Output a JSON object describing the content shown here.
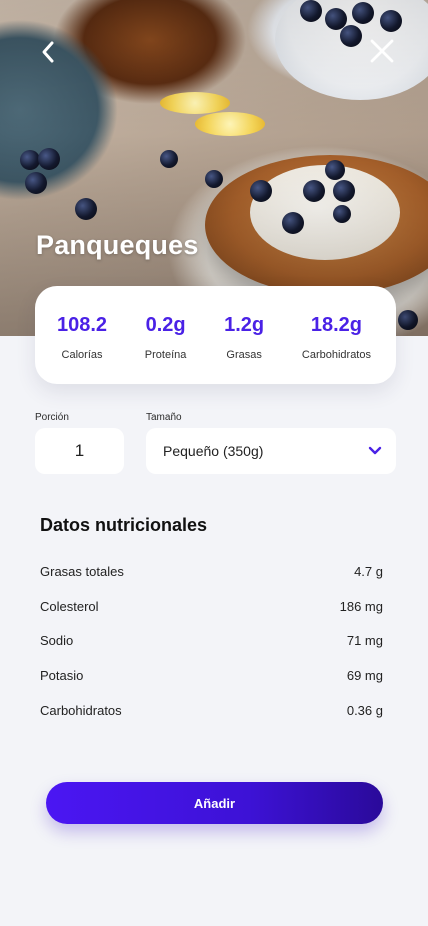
{
  "header": {
    "title": "Panqueques"
  },
  "stats": [
    {
      "value": "108.2",
      "label": "Calorías"
    },
    {
      "value": "0.2g",
      "label": "Proteína"
    },
    {
      "value": "1.2g",
      "label": "Grasas"
    },
    {
      "value": "18.2g",
      "label": "Carbohidratos"
    }
  ],
  "portion": {
    "label": "Porción",
    "value": "1"
  },
  "size": {
    "label": "Tamaño",
    "selected": "Pequeño (350g)"
  },
  "nutrition": {
    "title": "Datos nutricionales",
    "rows": [
      {
        "name": "Grasas totales",
        "amount": "4.7 g"
      },
      {
        "name": "Colesterol",
        "amount": "186 mg"
      },
      {
        "name": "Sodio",
        "amount": "71 mg"
      },
      {
        "name": "Potasio",
        "amount": "69 mg"
      },
      {
        "name": "Carbohidratos",
        "amount": "0.36 g"
      }
    ]
  },
  "cta": {
    "label": "Añadir"
  },
  "colors": {
    "accent": "#4a21e6",
    "background": "#f3f4f8",
    "card": "#ffffff"
  },
  "icons": {
    "back": "chevron-left-icon",
    "close": "close-icon",
    "dropdown": "chevron-down-icon"
  }
}
